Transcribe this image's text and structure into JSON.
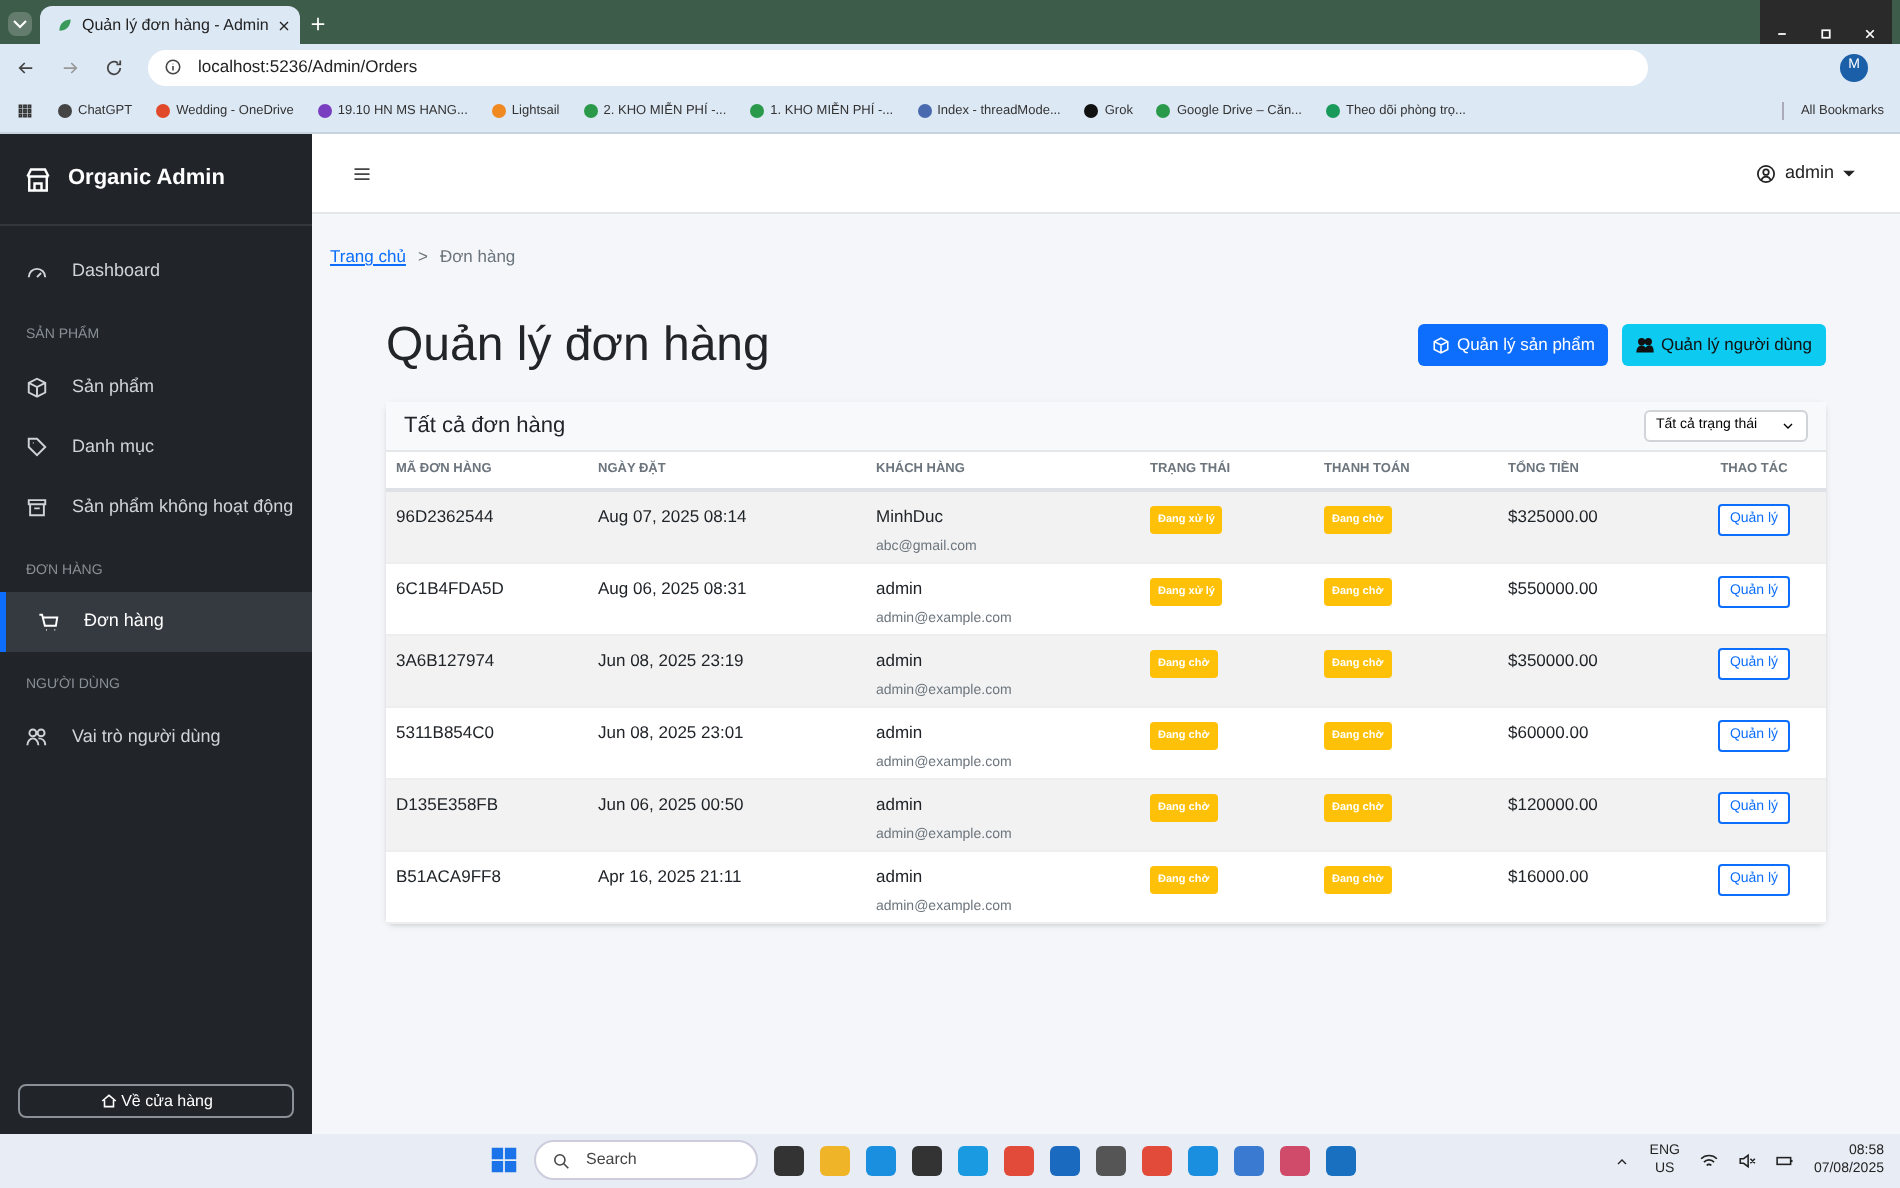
{
  "browser": {
    "tabs": [
      {
        "title": "Quản lý đơn hàng - Admin",
        "selected": true
      }
    ],
    "address": "localhost:5236/Admin/Orders",
    "profile": "M",
    "bookmarks": [
      "ChatGPT",
      "Wedding - OneDrive",
      "19.10 HN MS HANG...",
      "Lightsail",
      "2. KHO MIỄN PHÍ -...",
      "1. KHO MIỄN PHÍ -...",
      "Index - threadMode...",
      "Grok",
      "Google Drive – Căn...",
      "Theo dõi phòng trọ..."
    ],
    "all_bookmarks": "All Bookmarks"
  },
  "sidebar": {
    "brand": "Organic Admin",
    "items": [
      {
        "kind": "link",
        "label": "Dashboard",
        "selected": false
      },
      {
        "kind": "heading",
        "label": "SẢN PHẨM"
      },
      {
        "kind": "link",
        "label": "Sản phẩm",
        "selected": false
      },
      {
        "kind": "link",
        "label": "Danh mục",
        "selected": false
      },
      {
        "kind": "link",
        "label": "Sản phẩm không hoạt động",
        "selected": false
      },
      {
        "kind": "heading",
        "label": "ĐƠN HÀNG"
      },
      {
        "kind": "link",
        "label": "Đơn hàng",
        "selected": true
      },
      {
        "kind": "heading",
        "label": "NGƯỜI DÙNG"
      },
      {
        "kind": "link",
        "label": "Vai trò người dùng",
        "selected": false
      }
    ],
    "footer_button": "Về cửa hàng"
  },
  "topbar": {
    "user": "admin"
  },
  "breadcrumb": [
    {
      "label": "Trang chủ",
      "link": true
    },
    {
      "label": ">",
      "link": false
    },
    {
      "label": "Đơn hàng",
      "link": false
    }
  ],
  "title": "Quản lý đơn hàng",
  "actions": [
    "Quản lý sản phẩm",
    "Quản lý người dùng"
  ],
  "card": {
    "title": "Tất cả đơn hàng",
    "filter": "Tất cả trạng thái",
    "columns": [
      "MÃ ĐƠN HÀNG",
      "NGÀY ĐẶT",
      "KHÁCH HÀNG",
      "TRẠNG THÁI",
      "THANH TOÁN",
      "TỔNG TIỀN",
      "THAO TÁC"
    ],
    "rows": [
      {
        "id": "96D2362544",
        "date": "Aug 07, 2025 08:14",
        "customer": "MinhDuc",
        "email": "abc@gmail.com",
        "status": "Đang xử lý",
        "payment": "Đang chờ",
        "total": "$325000.00",
        "action": "Quản lý"
      },
      {
        "id": "6C1B4FDA5D",
        "date": "Aug 06, 2025 08:31",
        "customer": "admin",
        "email": "admin@example.com",
        "status": "Đang xử lý",
        "payment": "Đang chờ",
        "total": "$550000.00",
        "action": "Quản lý"
      },
      {
        "id": "3A6B127974",
        "date": "Jun 08, 2025 23:19",
        "customer": "admin",
        "email": "admin@example.com",
        "status": "Đang chờ",
        "payment": "Đang chờ",
        "total": "$350000.00",
        "action": "Quản lý"
      },
      {
        "id": "5311B854C0",
        "date": "Jun 08, 2025 23:01",
        "customer": "admin",
        "email": "admin@example.com",
        "status": "Đang chờ",
        "payment": "Đang chờ",
        "total": "$60000.00",
        "action": "Quản lý"
      },
      {
        "id": "D135E358FB",
        "date": "Jun 06, 2025 00:50",
        "customer": "admin",
        "email": "admin@example.com",
        "status": "Đang chờ",
        "payment": "Đang chờ",
        "total": "$120000.00",
        "action": "Quản lý"
      },
      {
        "id": "B51ACA9FF8",
        "date": "Apr 16, 2025 21:11",
        "customer": "admin",
        "email": "admin@example.com",
        "status": "Đang chờ",
        "payment": "Đang chờ",
        "total": "$16000.00",
        "action": "Quản lý"
      }
    ]
  },
  "taskbar": {
    "search": "Search",
    "lang": [
      "ENG",
      "US"
    ],
    "time": "08:58",
    "date": "07/08/2025"
  }
}
